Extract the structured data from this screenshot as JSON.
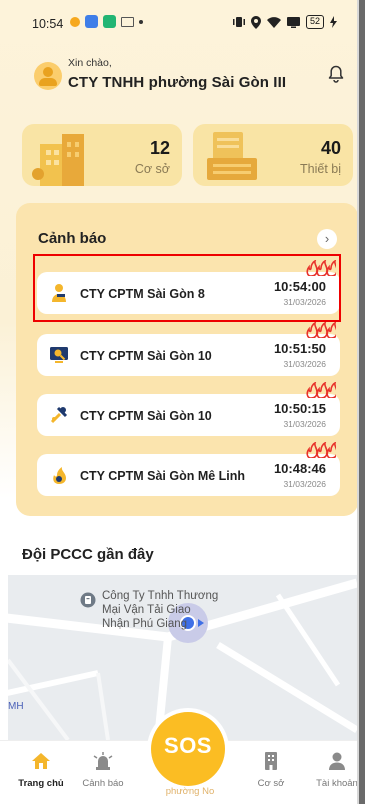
{
  "status_bar": {
    "time": "10:54",
    "battery": "52"
  },
  "header": {
    "greeting": "Xin chào,",
    "org_name": "CTY TNHH phường Sài Gòn III"
  },
  "stats": [
    {
      "value": "12",
      "label": "Cơ sở"
    },
    {
      "value": "40",
      "label": "Thiết bị"
    }
  ],
  "alerts": {
    "title": "Cảnh báo",
    "items": [
      {
        "name": "CTY CPTM Sài Gòn 8",
        "time": "10:54:00",
        "date": "31/03/2026",
        "icon": "person-icon"
      },
      {
        "name": "CTY CPTM Sài Gòn 10",
        "time": "10:51:50",
        "date": "31/03/2026",
        "icon": "monitor-search-icon"
      },
      {
        "name": "CTY CPTM Sài Gòn 10",
        "time": "10:50:15",
        "date": "31/03/2026",
        "icon": "tools-icon"
      },
      {
        "name": "CTY CPTM Sài Gòn Mê Linh",
        "time": "10:48:46",
        "date": "31/03/2026",
        "icon": "flame-icon"
      }
    ]
  },
  "nearby": {
    "title": "Đội PCCC gần đây",
    "map_poi": [
      "Công Ty Tnhh Thương",
      "Mại Vận Tải Giao",
      "Nhận Phú Giang"
    ],
    "map_edge_label": "MH"
  },
  "nav": {
    "items": [
      {
        "label": "Trang chủ",
        "icon": "home-icon"
      },
      {
        "label": "Cảnh báo",
        "icon": "siren-icon"
      },
      {
        "label": "Cơ sở",
        "icon": "building-icon"
      },
      {
        "label": "Tài khoản",
        "icon": "user-icon"
      }
    ],
    "sos_label": "SOS",
    "sos_caption": "phường No"
  },
  "colors": {
    "accent": "#fbbd23",
    "panel": "#fbe4ae",
    "highlight": "#ee0000",
    "fire": "#e8322b"
  }
}
